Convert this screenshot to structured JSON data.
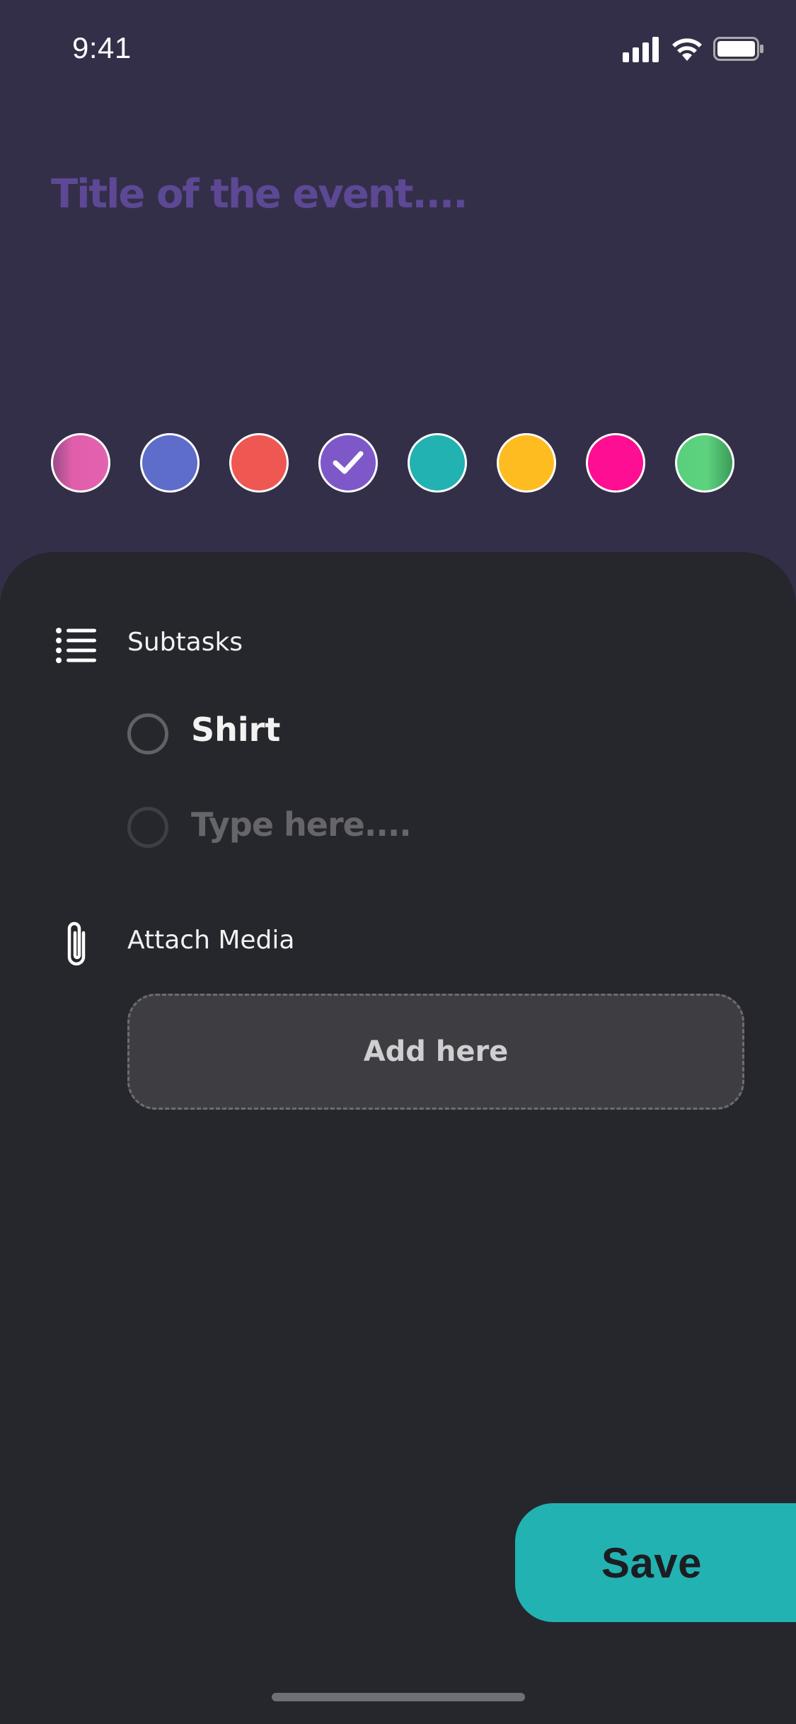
{
  "status_bar": {
    "time": "9:41"
  },
  "event": {
    "title_placeholder": "Title of the event...."
  },
  "colors": {
    "swatches": [
      {
        "name": "pink-gradient",
        "color": "#e05eaa",
        "selected": false
      },
      {
        "name": "indigo",
        "color": "#5e6dc9",
        "selected": false
      },
      {
        "name": "coral-red",
        "color": "#ef5752",
        "selected": false
      },
      {
        "name": "purple",
        "color": "#7e58c8",
        "selected": true
      },
      {
        "name": "teal",
        "color": "#22b2b1",
        "selected": false
      },
      {
        "name": "amber",
        "color": "#ffbc21",
        "selected": false
      },
      {
        "name": "magenta",
        "color": "#fe0e92",
        "selected": false
      },
      {
        "name": "green-gradient",
        "color": "#58d07c",
        "selected": false
      }
    ]
  },
  "subtasks": {
    "label": "Subtasks",
    "items": [
      {
        "text": "Shirt",
        "checked": false
      }
    ],
    "new_placeholder": "Type here...."
  },
  "media": {
    "label": "Attach Media",
    "add_label": "Add here"
  },
  "actions": {
    "save_label": "Save"
  },
  "theme": {
    "header_bg": "#342f48",
    "sheet_bg": "#26272d",
    "accent": "#22b2b1",
    "title_placeholder_color": "#5d4895"
  }
}
